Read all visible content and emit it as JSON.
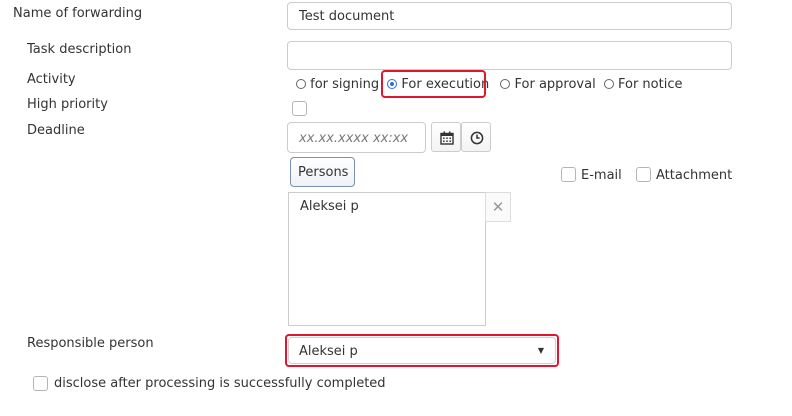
{
  "form": {
    "name_of_forwarding": {
      "label": "Name of forwarding",
      "value": "Test document"
    },
    "task_description": {
      "label": "Task description",
      "value": ""
    },
    "activity": {
      "label": "Activity",
      "options": [
        {
          "label": "for signing",
          "selected": false
        },
        {
          "label": "For execution",
          "selected": true
        },
        {
          "label": "For approval",
          "selected": false
        },
        {
          "label": "For notice",
          "selected": false
        }
      ]
    },
    "high_priority": {
      "label": "High priority",
      "checked": false
    },
    "deadline": {
      "label": "Deadline",
      "placeholder": "xx.xx.xxxx xx:xx"
    },
    "persons": {
      "button_label": "Persons",
      "email_label": "E-mail",
      "attachment_label": "Attachment",
      "list": [
        "Aleksei p"
      ],
      "clear_glyph": "✕"
    },
    "responsible_person": {
      "label": "Responsible person",
      "value": "Aleksei p",
      "arrow": "▼"
    },
    "disclose": {
      "label": "disclose after processing is successfully completed",
      "checked": false
    }
  },
  "colors": {
    "highlight": "#e0152f",
    "radio_selected": "#2d6fd6"
  },
  "icons": {
    "calendar": "calendar-icon",
    "clock": "clock-icon"
  }
}
